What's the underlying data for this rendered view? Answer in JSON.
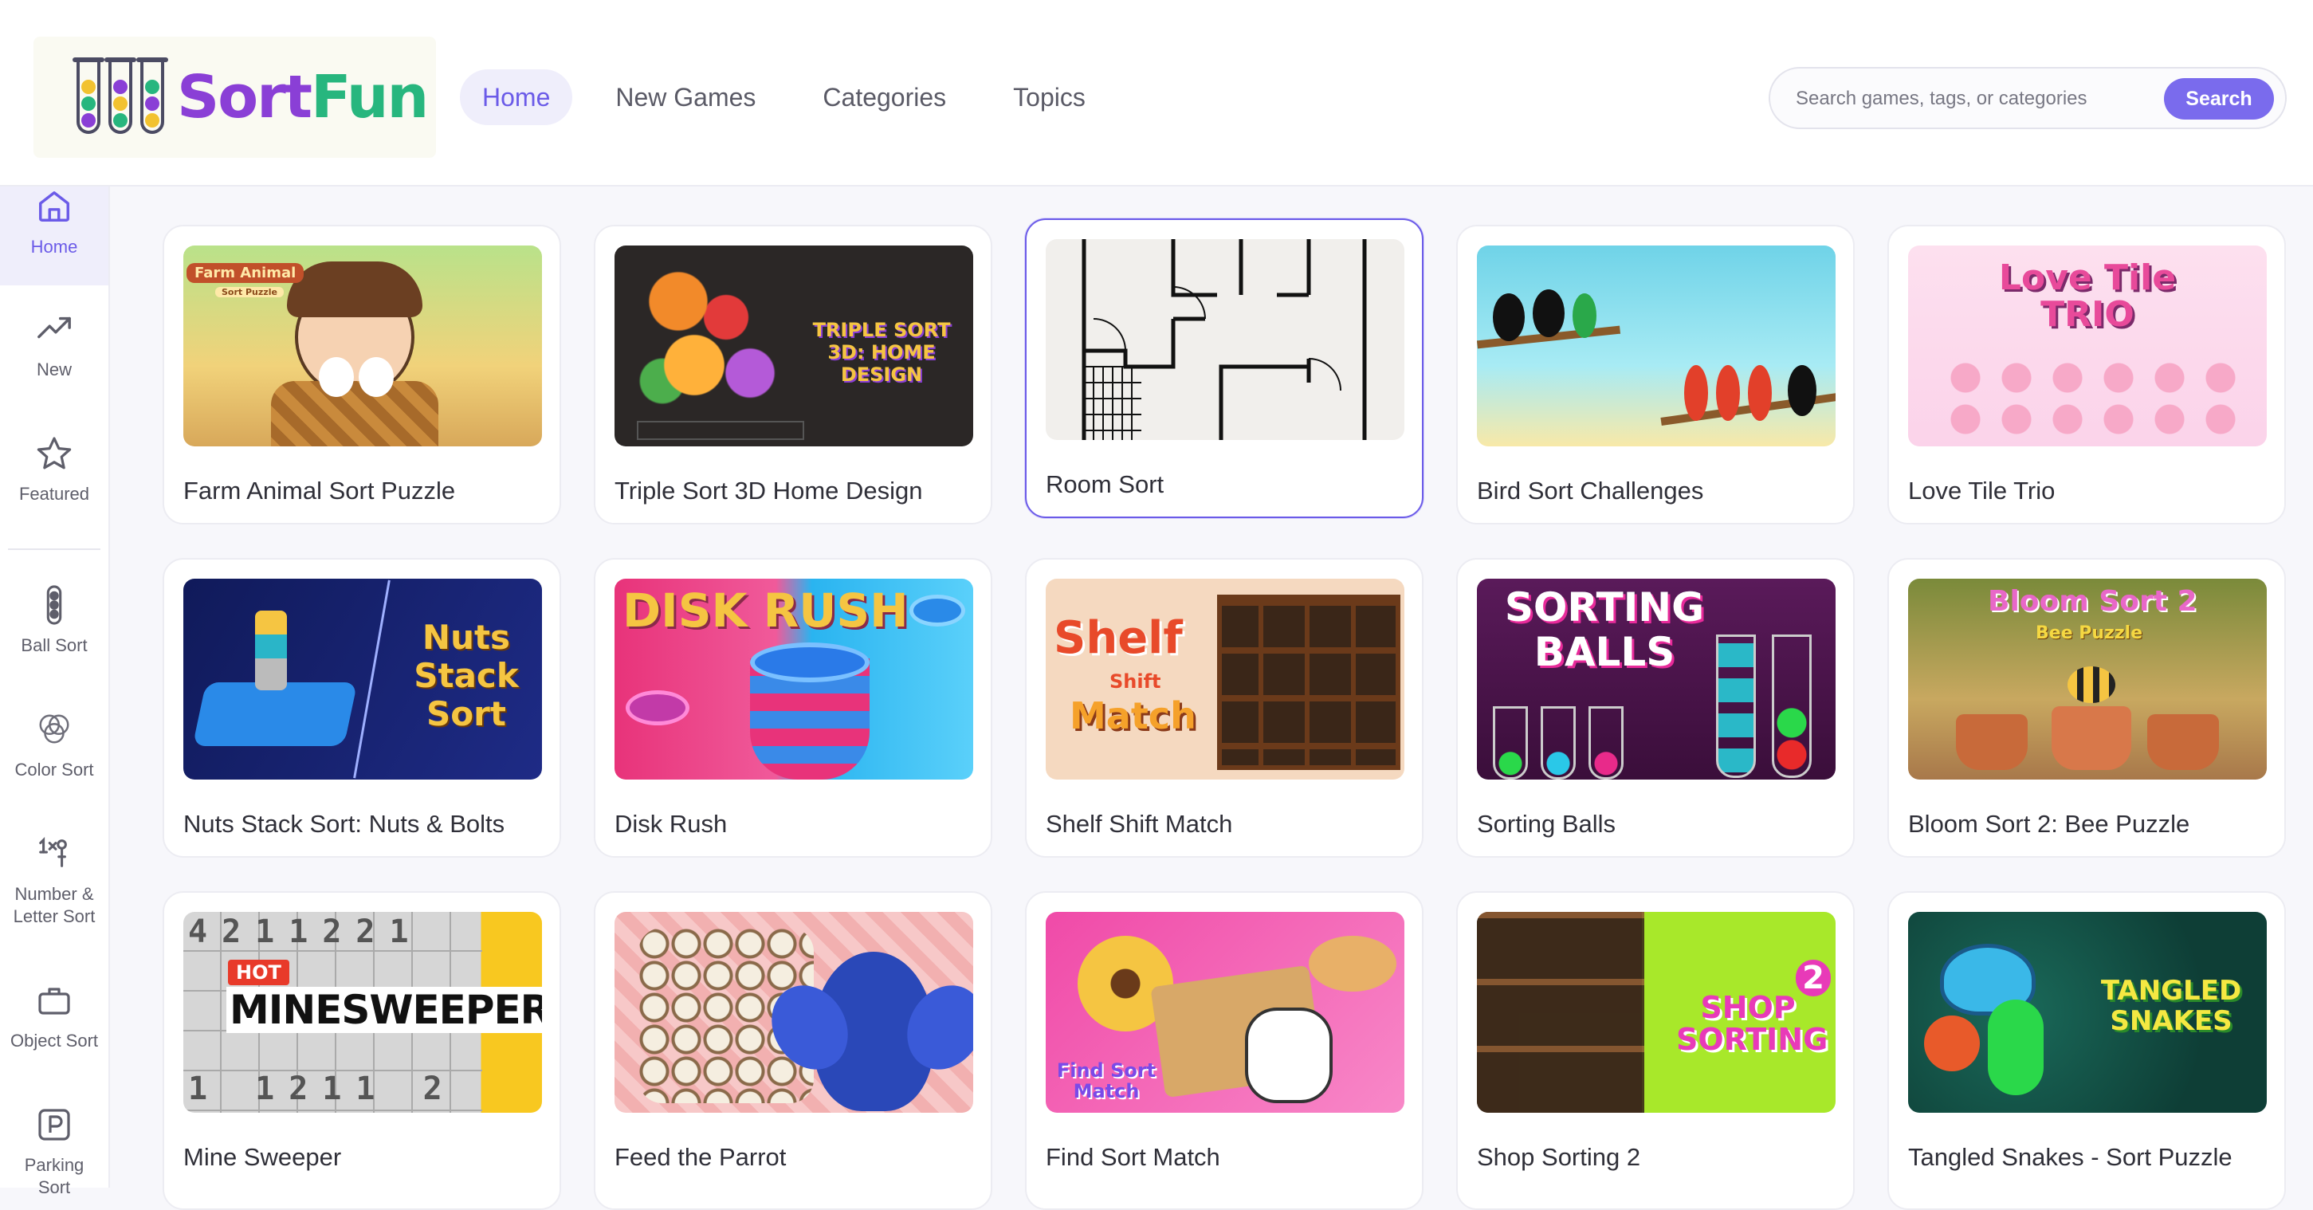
{
  "header": {
    "logo": {
      "sort": "Sort",
      "fun": "Fun"
    },
    "nav": [
      {
        "label": "Home",
        "active": true
      },
      {
        "label": "New Games",
        "active": false
      },
      {
        "label": "Categories",
        "active": false
      },
      {
        "label": "Topics",
        "active": false
      }
    ],
    "search": {
      "placeholder": "Search games, tags, or categories",
      "value": "",
      "button_label": "Search"
    }
  },
  "sidebar": {
    "items": [
      {
        "label": "Home",
        "icon": "home-icon",
        "active": true
      },
      {
        "label": "New",
        "icon": "trending-icon"
      },
      {
        "label": "Featured",
        "icon": "star-icon"
      },
      {
        "label": "Ball Sort",
        "icon": "ball-tube-icon"
      },
      {
        "label": "Color Sort",
        "icon": "color-circles-icon"
      },
      {
        "label": "Number & Letter Sort",
        "icon": "number-letter-icon"
      },
      {
        "label": "Object Sort",
        "icon": "briefcase-icon"
      },
      {
        "label": "Parking Sort",
        "icon": "parking-icon"
      }
    ]
  },
  "games": [
    {
      "title": "Farm Animal Sort Puzzle",
      "thumb_text": "Farm Animal",
      "thumb_sub": "Sort Puzzle"
    },
    {
      "title": "Triple Sort 3D Home Design",
      "thumb_text": "TRIPLE SORT 3D: HOME DESIGN"
    },
    {
      "title": "Room Sort",
      "selected": true
    },
    {
      "title": "Bird Sort Challenges"
    },
    {
      "title": "Love Tile Trio",
      "thumb_text": "Love Tile TRIO"
    },
    {
      "title": "Nuts Stack Sort: Nuts & Bolts",
      "thumb_text": "Nuts Stack Sort"
    },
    {
      "title": "Disk Rush",
      "thumb_text": "DISK RUSH"
    },
    {
      "title": "Shelf Shift Match",
      "thumb_text": "Shelf",
      "thumb_sub": "Shift",
      "thumb_sub2": "Match"
    },
    {
      "title": "Sorting Balls",
      "thumb_text": "SORTING BALLS"
    },
    {
      "title": "Bloom Sort 2: Bee Puzzle",
      "thumb_text": "Bloom Sort 2",
      "thumb_sub": "Bee Puzzle"
    },
    {
      "title": "Mine Sweeper",
      "thumb_text": "MINESWEEPER",
      "thumb_badge": "HOT"
    },
    {
      "title": "Feed the Parrot"
    },
    {
      "title": "Find Sort Match",
      "thumb_text": "Find Sort Match"
    },
    {
      "title": "Shop Sorting 2",
      "thumb_text": "SHOP SORTING",
      "thumb_sub": "2"
    },
    {
      "title": "Tangled Snakes - Sort Puzzle",
      "thumb_text": "TANGLED SNAKES"
    }
  ]
}
